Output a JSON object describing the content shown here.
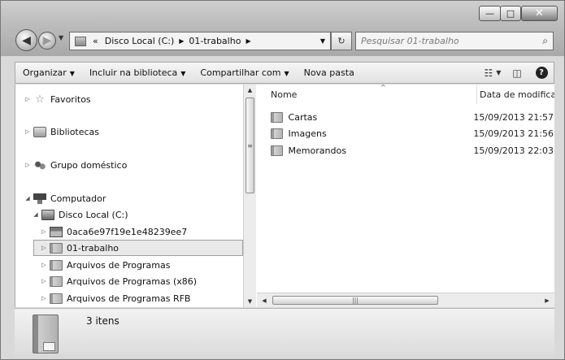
{
  "window": {
    "controls": {
      "minimize": "—",
      "maximize": "□",
      "close": "✕"
    }
  },
  "nav": {
    "back_glyph": "◀",
    "forward_glyph": "▶",
    "breadcrumb": {
      "overflow": "«",
      "segments": [
        "Disco Local (C:)",
        "01-trabalho"
      ]
    },
    "refresh_glyph": "↻",
    "search_placeholder": "Pesquisar 01-trabalho"
  },
  "toolbar": {
    "organize": "Organizar",
    "include_library": "Incluir na biblioteca",
    "share": "Compartilhar com",
    "new_folder": "Nova pasta"
  },
  "sidebar": {
    "items": [
      {
        "label": "Favoritos",
        "icon": "star-icon"
      },
      {
        "label": "Bibliotecas",
        "icon": "library-icon"
      },
      {
        "label": "Grupo doméstico",
        "icon": "homegroup-icon"
      },
      {
        "label": "Computador",
        "icon": "computer-icon"
      },
      {
        "label": "Disco Local (C:)",
        "icon": "drive-icon"
      },
      {
        "label": "0aca6e97f19e1e48239ee7",
        "icon": "folder-icon"
      },
      {
        "label": "01-trabalho",
        "icon": "folder-icon",
        "selected": true
      },
      {
        "label": "Arquivos de Programas",
        "icon": "folder-icon"
      },
      {
        "label": "Arquivos de Programas (x86)",
        "icon": "folder-icon"
      },
      {
        "label": "Arquivos de Programas RFB",
        "icon": "folder-icon"
      }
    ]
  },
  "content": {
    "columns": {
      "name": "Nome",
      "date": "Data de modificação"
    },
    "files": [
      {
        "name": "Cartas",
        "date": "15/09/2013 21:57"
      },
      {
        "name": "Imagens",
        "date": "15/09/2013 21:56"
      },
      {
        "name": "Memorandos",
        "date": "15/09/2013 22:03"
      }
    ]
  },
  "status": {
    "count": "3 itens"
  }
}
